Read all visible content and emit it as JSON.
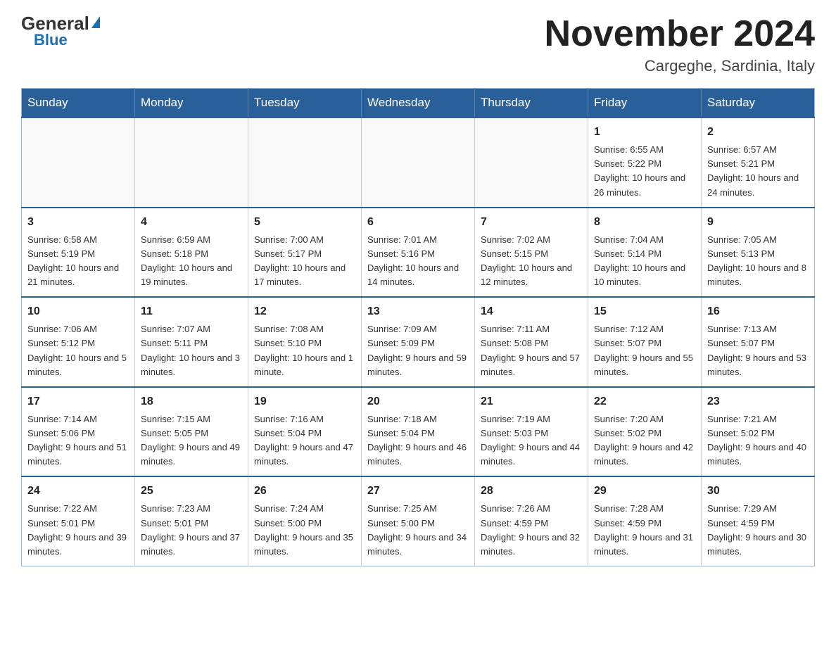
{
  "logo": {
    "general": "General",
    "blue": "Blue",
    "triangle": "▲"
  },
  "title": "November 2024",
  "subtitle": "Cargeghe, Sardinia, Italy",
  "days_of_week": [
    "Sunday",
    "Monday",
    "Tuesday",
    "Wednesday",
    "Thursday",
    "Friday",
    "Saturday"
  ],
  "weeks": [
    [
      {
        "day": "",
        "info": ""
      },
      {
        "day": "",
        "info": ""
      },
      {
        "day": "",
        "info": ""
      },
      {
        "day": "",
        "info": ""
      },
      {
        "day": "",
        "info": ""
      },
      {
        "day": "1",
        "info": "Sunrise: 6:55 AM\nSunset: 5:22 PM\nDaylight: 10 hours and 26 minutes."
      },
      {
        "day": "2",
        "info": "Sunrise: 6:57 AM\nSunset: 5:21 PM\nDaylight: 10 hours and 24 minutes."
      }
    ],
    [
      {
        "day": "3",
        "info": "Sunrise: 6:58 AM\nSunset: 5:19 PM\nDaylight: 10 hours and 21 minutes."
      },
      {
        "day": "4",
        "info": "Sunrise: 6:59 AM\nSunset: 5:18 PM\nDaylight: 10 hours and 19 minutes."
      },
      {
        "day": "5",
        "info": "Sunrise: 7:00 AM\nSunset: 5:17 PM\nDaylight: 10 hours and 17 minutes."
      },
      {
        "day": "6",
        "info": "Sunrise: 7:01 AM\nSunset: 5:16 PM\nDaylight: 10 hours and 14 minutes."
      },
      {
        "day": "7",
        "info": "Sunrise: 7:02 AM\nSunset: 5:15 PM\nDaylight: 10 hours and 12 minutes."
      },
      {
        "day": "8",
        "info": "Sunrise: 7:04 AM\nSunset: 5:14 PM\nDaylight: 10 hours and 10 minutes."
      },
      {
        "day": "9",
        "info": "Sunrise: 7:05 AM\nSunset: 5:13 PM\nDaylight: 10 hours and 8 minutes."
      }
    ],
    [
      {
        "day": "10",
        "info": "Sunrise: 7:06 AM\nSunset: 5:12 PM\nDaylight: 10 hours and 5 minutes."
      },
      {
        "day": "11",
        "info": "Sunrise: 7:07 AM\nSunset: 5:11 PM\nDaylight: 10 hours and 3 minutes."
      },
      {
        "day": "12",
        "info": "Sunrise: 7:08 AM\nSunset: 5:10 PM\nDaylight: 10 hours and 1 minute."
      },
      {
        "day": "13",
        "info": "Sunrise: 7:09 AM\nSunset: 5:09 PM\nDaylight: 9 hours and 59 minutes."
      },
      {
        "day": "14",
        "info": "Sunrise: 7:11 AM\nSunset: 5:08 PM\nDaylight: 9 hours and 57 minutes."
      },
      {
        "day": "15",
        "info": "Sunrise: 7:12 AM\nSunset: 5:07 PM\nDaylight: 9 hours and 55 minutes."
      },
      {
        "day": "16",
        "info": "Sunrise: 7:13 AM\nSunset: 5:07 PM\nDaylight: 9 hours and 53 minutes."
      }
    ],
    [
      {
        "day": "17",
        "info": "Sunrise: 7:14 AM\nSunset: 5:06 PM\nDaylight: 9 hours and 51 minutes."
      },
      {
        "day": "18",
        "info": "Sunrise: 7:15 AM\nSunset: 5:05 PM\nDaylight: 9 hours and 49 minutes."
      },
      {
        "day": "19",
        "info": "Sunrise: 7:16 AM\nSunset: 5:04 PM\nDaylight: 9 hours and 47 minutes."
      },
      {
        "day": "20",
        "info": "Sunrise: 7:18 AM\nSunset: 5:04 PM\nDaylight: 9 hours and 46 minutes."
      },
      {
        "day": "21",
        "info": "Sunrise: 7:19 AM\nSunset: 5:03 PM\nDaylight: 9 hours and 44 minutes."
      },
      {
        "day": "22",
        "info": "Sunrise: 7:20 AM\nSunset: 5:02 PM\nDaylight: 9 hours and 42 minutes."
      },
      {
        "day": "23",
        "info": "Sunrise: 7:21 AM\nSunset: 5:02 PM\nDaylight: 9 hours and 40 minutes."
      }
    ],
    [
      {
        "day": "24",
        "info": "Sunrise: 7:22 AM\nSunset: 5:01 PM\nDaylight: 9 hours and 39 minutes."
      },
      {
        "day": "25",
        "info": "Sunrise: 7:23 AM\nSunset: 5:01 PM\nDaylight: 9 hours and 37 minutes."
      },
      {
        "day": "26",
        "info": "Sunrise: 7:24 AM\nSunset: 5:00 PM\nDaylight: 9 hours and 35 minutes."
      },
      {
        "day": "27",
        "info": "Sunrise: 7:25 AM\nSunset: 5:00 PM\nDaylight: 9 hours and 34 minutes."
      },
      {
        "day": "28",
        "info": "Sunrise: 7:26 AM\nSunset: 4:59 PM\nDaylight: 9 hours and 32 minutes."
      },
      {
        "day": "29",
        "info": "Sunrise: 7:28 AM\nSunset: 4:59 PM\nDaylight: 9 hours and 31 minutes."
      },
      {
        "day": "30",
        "info": "Sunrise: 7:29 AM\nSunset: 4:59 PM\nDaylight: 9 hours and 30 minutes."
      }
    ]
  ]
}
